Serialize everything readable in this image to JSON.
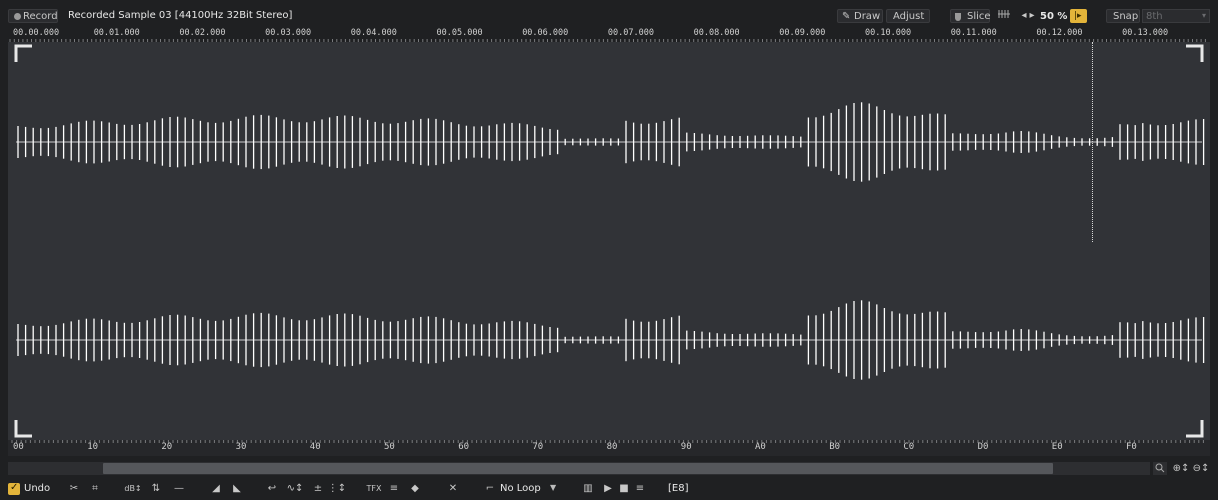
{
  "top": {
    "record_label": "Record",
    "sample_title": "Recorded Sample 03 [44100Hz 32Bit Stereo]",
    "draw_label": "Draw",
    "adjust_label": "Adjust",
    "slice_label": "Slice",
    "zoom_value": "50 %",
    "snap_label": "Snap",
    "snap_value": "8th"
  },
  "time_ruler": [
    "00.00.000",
    "00.01.000",
    "00.02.000",
    "00.03.000",
    "00.04.000",
    "00.05.000",
    "00.06.000",
    "00.07.000",
    "00.08.000",
    "00.09.000",
    "00.10.000",
    "00.11.000",
    "00.12.000",
    "00.13.000"
  ],
  "line_ruler": [
    "00",
    "10",
    "20",
    "30",
    "40",
    "50",
    "60",
    "70",
    "80",
    "90",
    "A0",
    "B0",
    "C0",
    "D0",
    "E0",
    "F0"
  ],
  "bottom": {
    "undo_label": "Undo",
    "loop_value": "No Loop",
    "note_value": "[E8]"
  },
  "colors": {
    "background": "#1f2022",
    "wave_bg": "#313337",
    "waveform": "#ffffff",
    "accent": "#e3b43a"
  }
}
